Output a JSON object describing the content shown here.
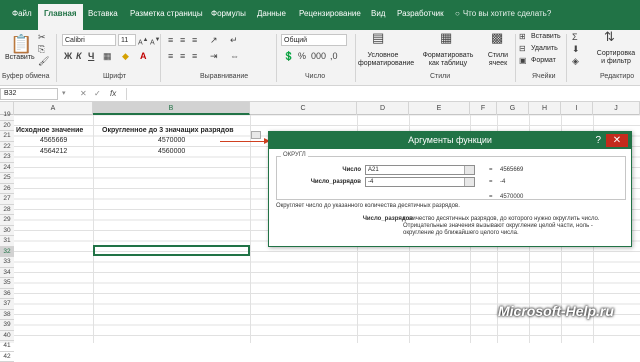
{
  "tabs": [
    "Файл",
    "Главная",
    "Вставка",
    "Разметка страницы",
    "Формулы",
    "Данные",
    "Рецензирование",
    "Вид",
    "Разработчик"
  ],
  "tell_me": "Что вы хотите сделать?",
  "ribbon": {
    "paste": "Вставить",
    "clipboard": "Буфер обмена",
    "font_name": "Calibri",
    "font_size": "11",
    "font": "Шрифт",
    "alignment": "Выравнивание",
    "number_format": "Общий",
    "number": "Число",
    "cond_format": "Условное форматирование",
    "format_table": "Форматировать как таблицу",
    "cell_styles": "Стили ячеек",
    "styles": "Стили",
    "insert": "Вставить",
    "delete": "Удалить",
    "format": "Формат",
    "cells": "Ячейки",
    "sort_filter": "Сортировка и фильтр",
    "editing": "Редактиро",
    "bold": "Ж",
    "italic": "К",
    "underline": "Ч"
  },
  "name_box": "B32",
  "fx": "fx",
  "columns": [
    "A",
    "B",
    "C",
    "D",
    "E",
    "F",
    "G",
    "H",
    "I",
    "J"
  ],
  "rows": [
    "19",
    "20",
    "21",
    "22",
    "23",
    "24",
    "25",
    "26",
    "27",
    "28",
    "29",
    "30",
    "31",
    "32",
    "33",
    "34",
    "35",
    "36",
    "37",
    "38",
    "39",
    "40",
    "41",
    "42"
  ],
  "cells": {
    "a20": "Исходное значение",
    "b20": "Округленное до 3 значащих разрядов",
    "a21": "4565669",
    "b21": "4570000",
    "a22": "4564212",
    "b22": "4560000"
  },
  "dialog": {
    "title": "Аргументы функции",
    "help": "?",
    "close": "✕",
    "func": "ОКРУГЛ",
    "arg1_label": "Число",
    "arg1_value": "A21",
    "arg1_result": "4565669",
    "arg2_label": "Число_разрядов",
    "arg2_value": "-4",
    "arg2_result": "-4",
    "result": "4570000",
    "desc": "Округляет число до указанного количества десятичных разрядов.",
    "help_label": "Число_разрядов",
    "help_text": "количество десятичных разрядов, до которого нужно округлить число. Отрицательные значения вызывают округление целой части, ноль - округление до ближайшего целого числа."
  },
  "watermark": "Microsoft-Help.ru"
}
